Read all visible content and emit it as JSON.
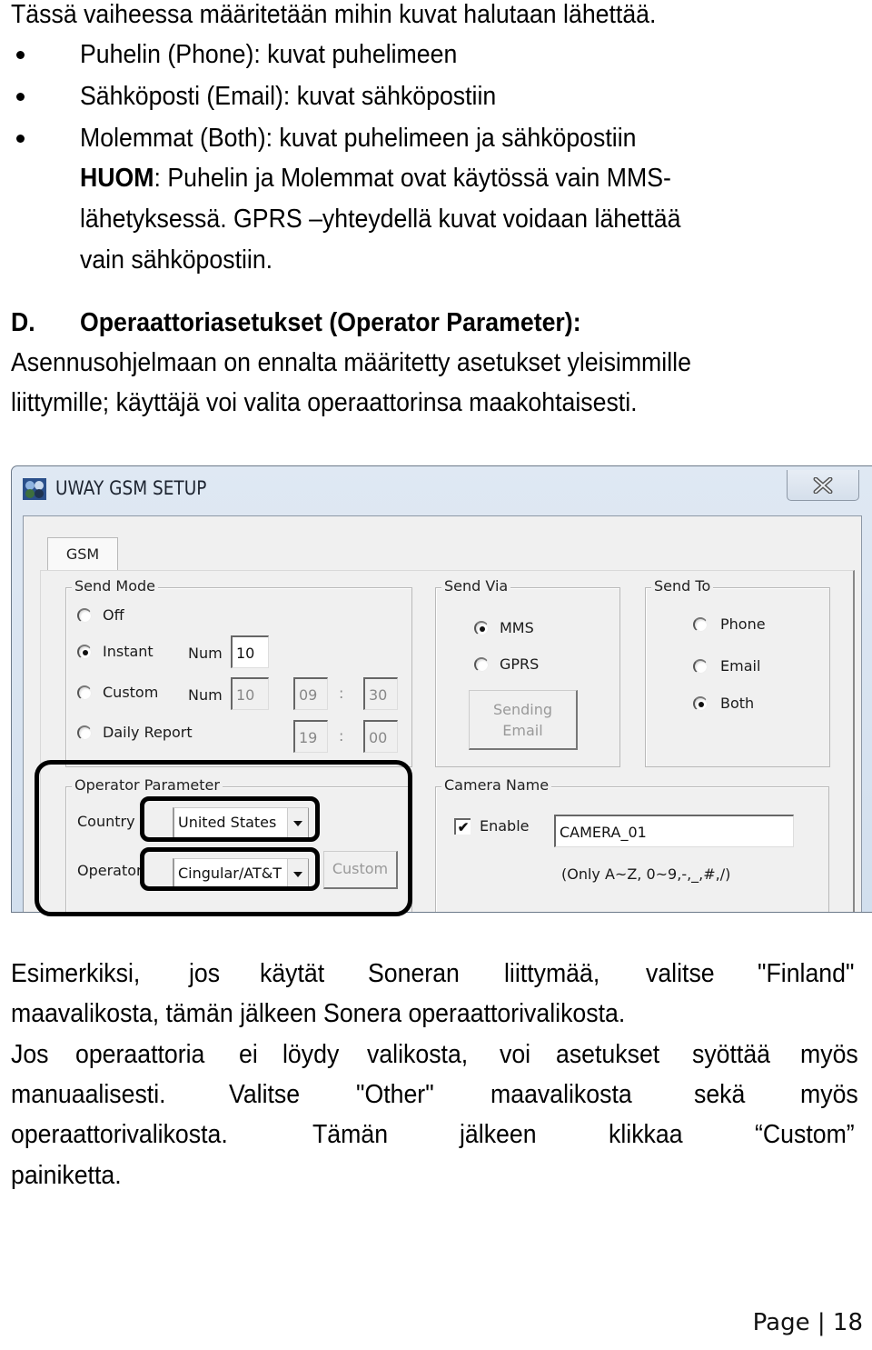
{
  "intro": {
    "line": "Tässä vaiheessa määritetään mihin kuvat halutaan lähettää.",
    "bullets": [
      "Puhelin (Phone): kuvat puhelimeen",
      "Sähköposti (Email): kuvat sähköpostiin",
      "Molemmat (Both): kuvat puhelimeen ja sähköpostiin"
    ],
    "note_bold": "HUOM",
    "note_rest": ": Puhelin ja Molemmat ovat käytössä vain MMS-",
    "note_line2": "lähetyksessä. GPRS –yhteydellä kuvat voidaan lähettää",
    "note_line3": "vain sähköpostiin."
  },
  "section_d": {
    "letter": "D.",
    "heading": "Operaattoriasetukset (Operator Parameter):",
    "line1": "Asennusohjelmaan on ennalta määritetty asetukset yleisimmille",
    "line2": "liittymille; käyttäjä voi valita operaattorinsa maakohtaisesti."
  },
  "window": {
    "title": "UWAY GSM SETUP",
    "close_icon": "close-icon",
    "tab": "GSM",
    "send_mode": {
      "label": "Send Mode",
      "options": [
        "Off",
        "Instant",
        "Custom",
        "Daily Report"
      ],
      "selected": "Instant",
      "num_label": "Num",
      "instant_num": "10",
      "custom_num": "10",
      "custom_hour": "09",
      "custom_min": "30",
      "daily_hour": "19",
      "daily_min": "00",
      "colon": ":"
    },
    "send_via": {
      "label": "Send Via",
      "options": [
        "MMS",
        "GPRS"
      ],
      "selected": "MMS",
      "button_line1": "Sending",
      "button_line2": "Email"
    },
    "send_to": {
      "label": "Send To",
      "options": [
        "Phone",
        "Email",
        "Both"
      ],
      "selected": "Both"
    },
    "operator_parameter": {
      "label": "Operator Parameter",
      "country_label": "Country",
      "country_value": "United States",
      "operator_label": "Operator",
      "operator_value": "Cingular/AT&T",
      "custom_button": "Custom"
    },
    "camera_name": {
      "label": "Camera Name",
      "enable_label": "Enable",
      "enabled": true,
      "value": "CAMERA_01",
      "hint": "(Only A~Z, 0~9,-,_,#,/)"
    }
  },
  "outro": {
    "lines": [
      [
        "Esimerkiksi,",
        "jos",
        "käytät",
        "Soneran",
        "liittymää,",
        "valitse",
        "\"Finland\""
      ],
      [
        "maavalikosta, tämän jälkeen Sonera operaattorivalikosta."
      ],
      [
        "Jos",
        "operaattoria",
        "ei",
        "löydy",
        "valikosta,",
        "voi",
        "asetukset",
        "syöttää",
        "myös"
      ],
      [
        "manuaalisesti.",
        "Valitse",
        "\"Other\"",
        "maavalikosta",
        "sekä",
        "myös"
      ],
      [
        "operaattorivalikosta.",
        "Tämän",
        "jälkeen",
        "klikkaa",
        "“Custom”"
      ],
      [
        "painiketta."
      ]
    ]
  },
  "footer": {
    "page_label": "Page",
    "separator": "|",
    "page_number": "18"
  }
}
